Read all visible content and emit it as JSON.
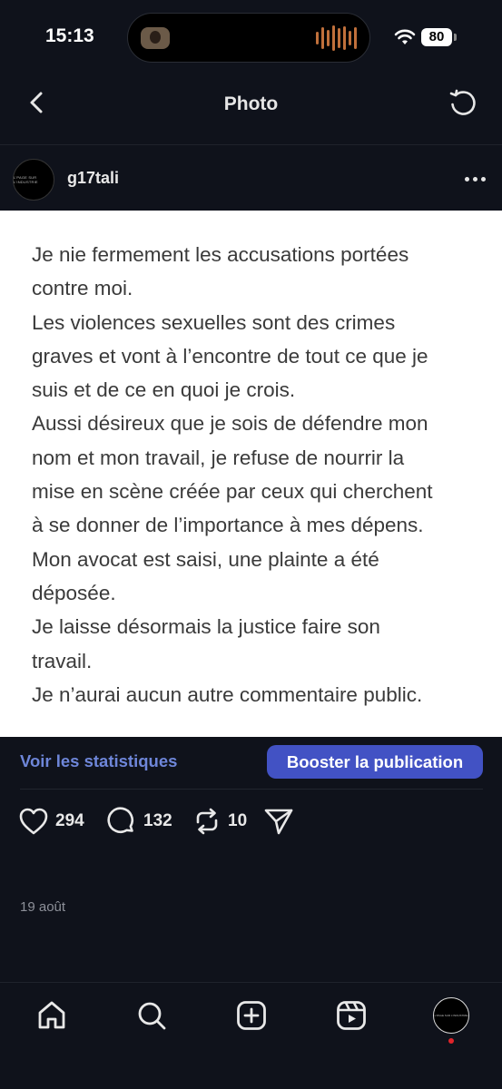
{
  "status_bar": {
    "time": "15:13",
    "battery": "80"
  },
  "header": {
    "title": "Photo"
  },
  "author": {
    "username": "g17tali",
    "avatar_text": "L'PAGE SUR L'INDUSTRIE"
  },
  "post": {
    "lines": [
      "Je nie fermement les accusations portées",
      "contre moi.",
      "Les violences sexuelles sont des crimes",
      "graves et vont à l’encontre de tout ce que je",
      "suis et de ce en quoi je crois.",
      "Aussi désireux que je sois de défendre mon",
      "nom et mon travail, je refuse de nourrir la",
      "mise en scène créée par ceux qui cherchent",
      "à se donner de l’importance à mes dépens.",
      "Mon avocat est saisi, une plainte a été",
      "déposée.",
      "Je laisse désormais la justice faire son",
      "travail.",
      "Je n’aurai aucun autre commentaire public."
    ],
    "date": "19 août"
  },
  "actions": {
    "stats_label": "Voir les statistiques",
    "boost_label": "Booster la publication"
  },
  "engagement": {
    "likes": "294",
    "comments": "132",
    "reposts": "10"
  },
  "icons": {
    "back": "chevron-left-icon",
    "refresh": "refresh-icon",
    "more": "more-dots-icon",
    "like": "heart-icon",
    "comment": "comment-bubble-icon",
    "repost": "repost-icon",
    "share": "send-icon",
    "home": "home-icon",
    "search": "search-icon",
    "create": "plus-square-icon",
    "reels": "reels-icon"
  },
  "colors": {
    "background": "#0f121b",
    "link": "#6e86d9",
    "boost_button": "#4252c4",
    "notification_dot": "#e0242a"
  }
}
